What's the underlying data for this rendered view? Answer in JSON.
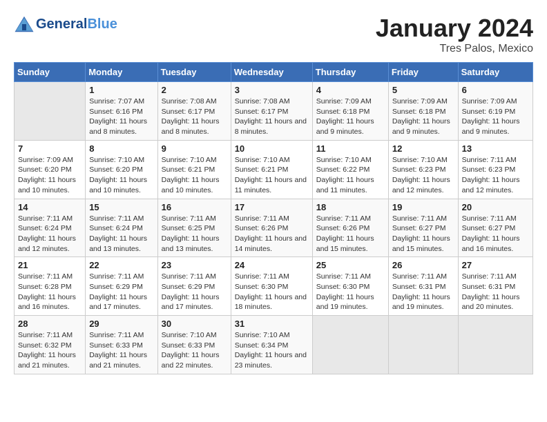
{
  "header": {
    "logo_general": "General",
    "logo_blue": "Blue",
    "title": "January 2024",
    "subtitle": "Tres Palos, Mexico"
  },
  "days_of_week": [
    "Sunday",
    "Monday",
    "Tuesday",
    "Wednesday",
    "Thursday",
    "Friday",
    "Saturday"
  ],
  "weeks": [
    [
      {
        "day": "",
        "info": ""
      },
      {
        "day": "1",
        "sunrise": "Sunrise: 7:07 AM",
        "sunset": "Sunset: 6:16 PM",
        "daylight": "Daylight: 11 hours and 8 minutes."
      },
      {
        "day": "2",
        "sunrise": "Sunrise: 7:08 AM",
        "sunset": "Sunset: 6:17 PM",
        "daylight": "Daylight: 11 hours and 8 minutes."
      },
      {
        "day": "3",
        "sunrise": "Sunrise: 7:08 AM",
        "sunset": "Sunset: 6:17 PM",
        "daylight": "Daylight: 11 hours and 8 minutes."
      },
      {
        "day": "4",
        "sunrise": "Sunrise: 7:09 AM",
        "sunset": "Sunset: 6:18 PM",
        "daylight": "Daylight: 11 hours and 9 minutes."
      },
      {
        "day": "5",
        "sunrise": "Sunrise: 7:09 AM",
        "sunset": "Sunset: 6:18 PM",
        "daylight": "Daylight: 11 hours and 9 minutes."
      },
      {
        "day": "6",
        "sunrise": "Sunrise: 7:09 AM",
        "sunset": "Sunset: 6:19 PM",
        "daylight": "Daylight: 11 hours and 9 minutes."
      }
    ],
    [
      {
        "day": "7",
        "sunrise": "Sunrise: 7:09 AM",
        "sunset": "Sunset: 6:20 PM",
        "daylight": "Daylight: 11 hours and 10 minutes."
      },
      {
        "day": "8",
        "sunrise": "Sunrise: 7:10 AM",
        "sunset": "Sunset: 6:20 PM",
        "daylight": "Daylight: 11 hours and 10 minutes."
      },
      {
        "day": "9",
        "sunrise": "Sunrise: 7:10 AM",
        "sunset": "Sunset: 6:21 PM",
        "daylight": "Daylight: 11 hours and 10 minutes."
      },
      {
        "day": "10",
        "sunrise": "Sunrise: 7:10 AM",
        "sunset": "Sunset: 6:21 PM",
        "daylight": "Daylight: 11 hours and 11 minutes."
      },
      {
        "day": "11",
        "sunrise": "Sunrise: 7:10 AM",
        "sunset": "Sunset: 6:22 PM",
        "daylight": "Daylight: 11 hours and 11 minutes."
      },
      {
        "day": "12",
        "sunrise": "Sunrise: 7:10 AM",
        "sunset": "Sunset: 6:23 PM",
        "daylight": "Daylight: 11 hours and 12 minutes."
      },
      {
        "day": "13",
        "sunrise": "Sunrise: 7:11 AM",
        "sunset": "Sunset: 6:23 PM",
        "daylight": "Daylight: 11 hours and 12 minutes."
      }
    ],
    [
      {
        "day": "14",
        "sunrise": "Sunrise: 7:11 AM",
        "sunset": "Sunset: 6:24 PM",
        "daylight": "Daylight: 11 hours and 12 minutes."
      },
      {
        "day": "15",
        "sunrise": "Sunrise: 7:11 AM",
        "sunset": "Sunset: 6:24 PM",
        "daylight": "Daylight: 11 hours and 13 minutes."
      },
      {
        "day": "16",
        "sunrise": "Sunrise: 7:11 AM",
        "sunset": "Sunset: 6:25 PM",
        "daylight": "Daylight: 11 hours and 13 minutes."
      },
      {
        "day": "17",
        "sunrise": "Sunrise: 7:11 AM",
        "sunset": "Sunset: 6:26 PM",
        "daylight": "Daylight: 11 hours and 14 minutes."
      },
      {
        "day": "18",
        "sunrise": "Sunrise: 7:11 AM",
        "sunset": "Sunset: 6:26 PM",
        "daylight": "Daylight: 11 hours and 15 minutes."
      },
      {
        "day": "19",
        "sunrise": "Sunrise: 7:11 AM",
        "sunset": "Sunset: 6:27 PM",
        "daylight": "Daylight: 11 hours and 15 minutes."
      },
      {
        "day": "20",
        "sunrise": "Sunrise: 7:11 AM",
        "sunset": "Sunset: 6:27 PM",
        "daylight": "Daylight: 11 hours and 16 minutes."
      }
    ],
    [
      {
        "day": "21",
        "sunrise": "Sunrise: 7:11 AM",
        "sunset": "Sunset: 6:28 PM",
        "daylight": "Daylight: 11 hours and 16 minutes."
      },
      {
        "day": "22",
        "sunrise": "Sunrise: 7:11 AM",
        "sunset": "Sunset: 6:29 PM",
        "daylight": "Daylight: 11 hours and 17 minutes."
      },
      {
        "day": "23",
        "sunrise": "Sunrise: 7:11 AM",
        "sunset": "Sunset: 6:29 PM",
        "daylight": "Daylight: 11 hours and 17 minutes."
      },
      {
        "day": "24",
        "sunrise": "Sunrise: 7:11 AM",
        "sunset": "Sunset: 6:30 PM",
        "daylight": "Daylight: 11 hours and 18 minutes."
      },
      {
        "day": "25",
        "sunrise": "Sunrise: 7:11 AM",
        "sunset": "Sunset: 6:30 PM",
        "daylight": "Daylight: 11 hours and 19 minutes."
      },
      {
        "day": "26",
        "sunrise": "Sunrise: 7:11 AM",
        "sunset": "Sunset: 6:31 PM",
        "daylight": "Daylight: 11 hours and 19 minutes."
      },
      {
        "day": "27",
        "sunrise": "Sunrise: 7:11 AM",
        "sunset": "Sunset: 6:31 PM",
        "daylight": "Daylight: 11 hours and 20 minutes."
      }
    ],
    [
      {
        "day": "28",
        "sunrise": "Sunrise: 7:11 AM",
        "sunset": "Sunset: 6:32 PM",
        "daylight": "Daylight: 11 hours and 21 minutes."
      },
      {
        "day": "29",
        "sunrise": "Sunrise: 7:11 AM",
        "sunset": "Sunset: 6:33 PM",
        "daylight": "Daylight: 11 hours and 21 minutes."
      },
      {
        "day": "30",
        "sunrise": "Sunrise: 7:10 AM",
        "sunset": "Sunset: 6:33 PM",
        "daylight": "Daylight: 11 hours and 22 minutes."
      },
      {
        "day": "31",
        "sunrise": "Sunrise: 7:10 AM",
        "sunset": "Sunset: 6:34 PM",
        "daylight": "Daylight: 11 hours and 23 minutes."
      },
      {
        "day": "",
        "info": ""
      },
      {
        "day": "",
        "info": ""
      },
      {
        "day": "",
        "info": ""
      }
    ]
  ]
}
